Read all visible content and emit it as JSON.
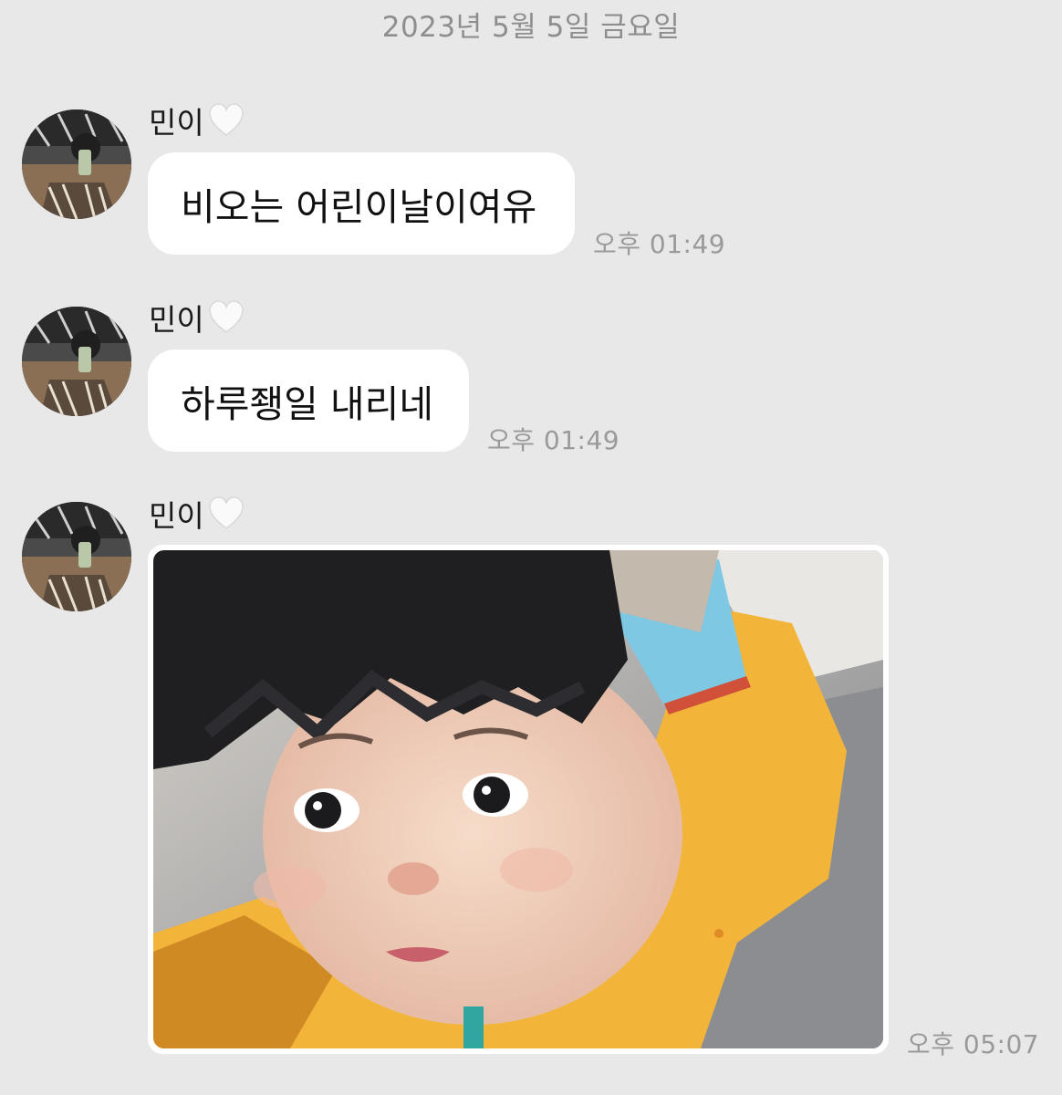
{
  "date_divider": "2023년 5월 5일 금요일",
  "messages": [
    {
      "sender": "민이",
      "text": "비오는 어린이날이여유",
      "time": "오후 01:49"
    },
    {
      "sender": "민이",
      "text": "하루좽일 내리네",
      "time": "오후 01:49"
    },
    {
      "sender": "민이",
      "image": "photo-of-child",
      "time": "오후 05:07"
    }
  ],
  "icons": {
    "heart": "white-heart-icon",
    "avatar": "profile-avatar-icon"
  },
  "colors": {
    "background": "#e8e8e8",
    "bubble": "#ffffff",
    "timestamp": "#9a9a9a"
  }
}
